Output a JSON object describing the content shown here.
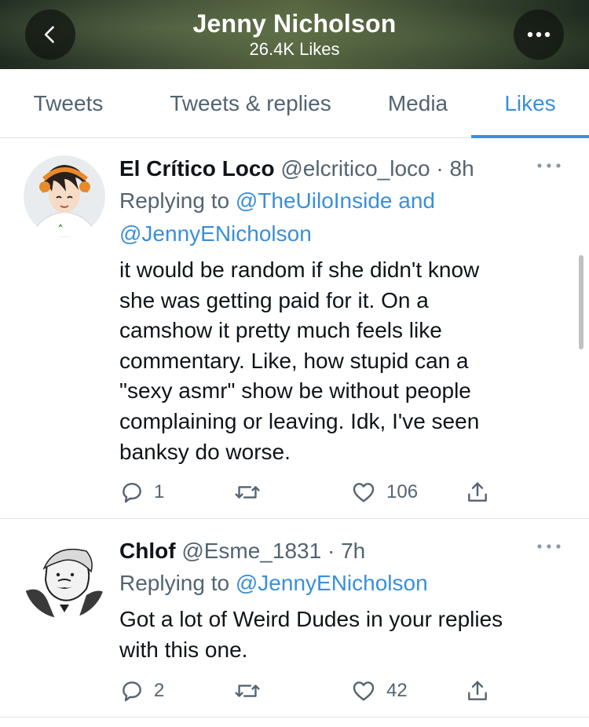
{
  "header": {
    "title": "Jenny Nicholson",
    "subtitle": "26.4K Likes",
    "back_icon": "chevron-left-icon",
    "more_icon": "more-horizontal-icon"
  },
  "tabs": [
    {
      "label": "Tweets",
      "active": false
    },
    {
      "label": "Tweets & replies",
      "active": false
    },
    {
      "label": "Media",
      "active": false
    },
    {
      "label": "Likes",
      "active": true
    }
  ],
  "tweets": [
    {
      "name": "El Crítico Loco",
      "handle": "@elcritico_loco",
      "separator": "·",
      "time": "8h",
      "replying_prefix": "Replying to",
      "mentions": [
        "@TheUiloInside",
        "@JennyENicholson"
      ],
      "mention_joiner": "and",
      "body_lines": [
        "it would be random if she didn't know",
        "she was getting paid for it. On a",
        "camshow it pretty much feels like",
        "commentary. Like, how stupid can a",
        "\"sexy asmr\" show be without people",
        "complaining or leaving. Idk, I've seen",
        "banksy do worse."
      ],
      "replies": "1",
      "retweets": "",
      "likes": "106"
    },
    {
      "name": "Chlof",
      "handle": "@Esme_1831",
      "separator": "·",
      "time": "7h",
      "replying_prefix": "Replying to",
      "mentions": [
        "@JennyENicholson"
      ],
      "body_lines": [
        "Got a lot of Weird Dudes in your replies",
        "with this one."
      ],
      "replies": "2",
      "retweets": "",
      "likes": "42"
    }
  ],
  "colors": {
    "accent": "#3a8fd9",
    "text": "#0f1419",
    "muted": "#536471",
    "divider": "#dfe3e6"
  }
}
